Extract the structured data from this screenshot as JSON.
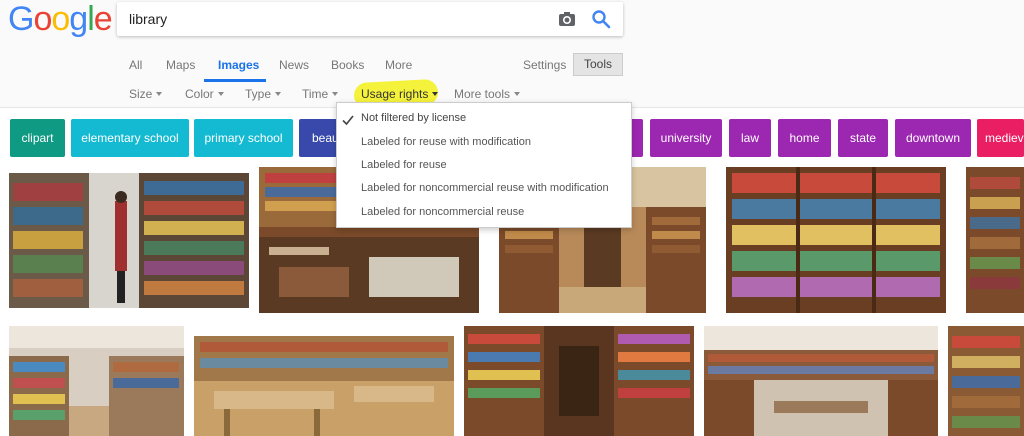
{
  "logo": {
    "letters": [
      {
        "char": "G",
        "color": "#4285f4"
      },
      {
        "char": "o",
        "color": "#ea4335"
      },
      {
        "char": "o",
        "color": "#fbbc05"
      },
      {
        "char": "g",
        "color": "#4285f4"
      },
      {
        "char": "l",
        "color": "#34a853"
      },
      {
        "char": "e",
        "color": "#ea4335"
      }
    ]
  },
  "search": {
    "value": "library",
    "camera_icon": "camera-icon",
    "search_icon": "magnifier-icon"
  },
  "nav": {
    "tabs": [
      "All",
      "Maps",
      "Images",
      "News",
      "Books",
      "More"
    ],
    "active": "Images",
    "settings": "Settings",
    "tools": "Tools"
  },
  "filters": {
    "items": [
      "Size",
      "Color",
      "Type",
      "Time",
      "Usage rights",
      "More tools"
    ],
    "highlighted": "Usage rights"
  },
  "usage_menu": {
    "items": [
      "Not filtered by license",
      "Labeled for reuse with modification",
      "Labeled for reuse",
      "Labeled for noncommercial reuse with modification",
      "Labeled for noncommercial reuse"
    ],
    "selected": "Not filtered by license"
  },
  "chips": [
    {
      "label": "clipart",
      "color": "#0e9a83"
    },
    {
      "label": "elementary school",
      "color": "#14bad2"
    },
    {
      "label": "primary school",
      "color": "#14bad2"
    },
    {
      "label": "beau",
      "color": "#3949ab"
    },
    {
      "label": "university",
      "color": "#9c27b0"
    },
    {
      "label": "law",
      "color": "#9c27b0"
    },
    {
      "label": "home",
      "color": "#9c27b0"
    },
    {
      "label": "state",
      "color": "#9c27b0"
    },
    {
      "label": "downtown",
      "color": "#9c27b0"
    },
    {
      "label": "mediev",
      "color": "#e91e63"
    }
  ],
  "colors": {
    "accent": "#1a73e8",
    "highlight": "#f4f23a"
  }
}
